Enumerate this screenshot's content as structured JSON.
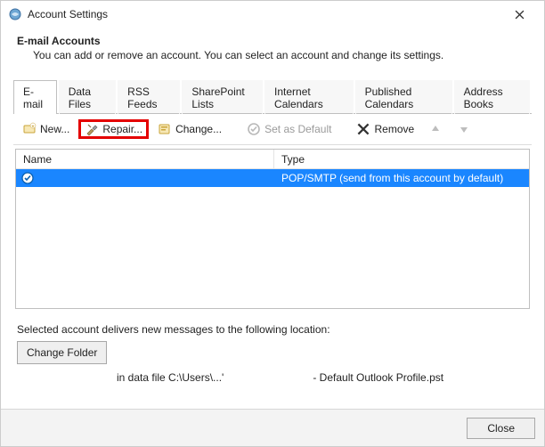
{
  "window": {
    "title": "Account Settings"
  },
  "header": {
    "title": "E-mail Accounts",
    "description": "You can add or remove an account. You can select an account and change its settings."
  },
  "tabs": [
    {
      "label": "E-mail",
      "active": true
    },
    {
      "label": "Data Files",
      "active": false
    },
    {
      "label": "RSS Feeds",
      "active": false
    },
    {
      "label": "SharePoint Lists",
      "active": false
    },
    {
      "label": "Internet Calendars",
      "active": false
    },
    {
      "label": "Published Calendars",
      "active": false
    },
    {
      "label": "Address Books",
      "active": false
    }
  ],
  "toolbar": {
    "new_label": "New...",
    "repair_label": "Repair...",
    "change_label": "Change...",
    "set_default_label": "Set as Default",
    "remove_label": "Remove"
  },
  "list": {
    "columns": {
      "name": "Name",
      "type": "Type"
    },
    "rows": [
      {
        "name": "",
        "type": "POP/SMTP (send from this account by default)",
        "selected": true,
        "default": true
      }
    ]
  },
  "footer": {
    "delivers_text": "Selected account delivers new messages to the following location:",
    "change_folder_label": "Change Folder",
    "location_left": "in data file C:\\Users\\...'",
    "location_right": "- Default Outlook Profile.pst"
  },
  "bottom": {
    "close_label": "Close"
  }
}
